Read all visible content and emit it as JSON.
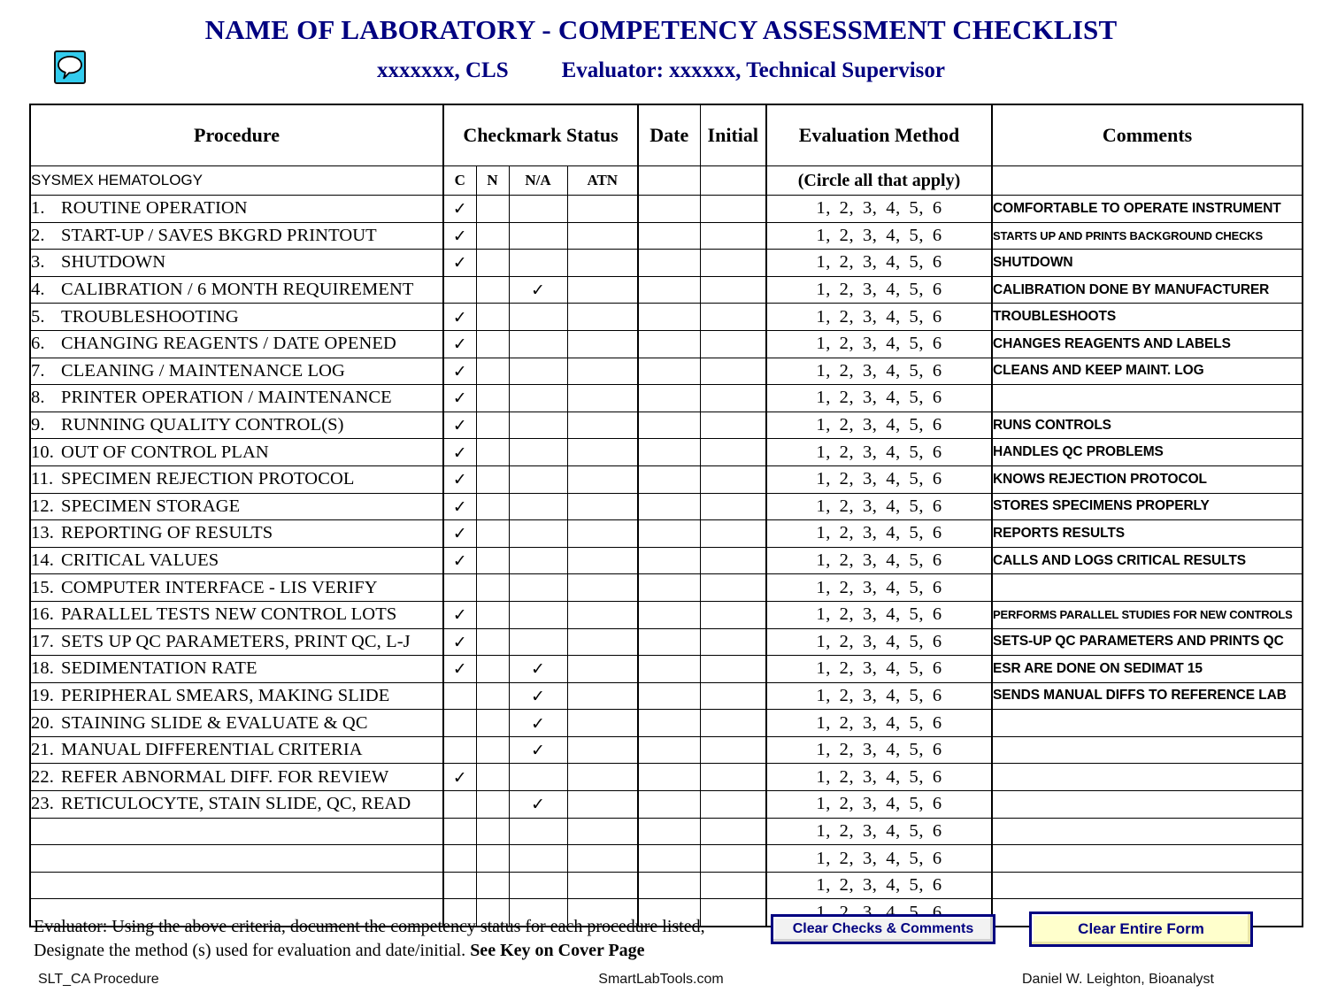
{
  "header": {
    "title": "NAME OF LABORATORY - COMPETENCY ASSESSMENT CHECKLIST",
    "employee": "xxxxxxx, CLS",
    "evaluator": "Evaluator: xxxxxx, Technical Supervisor",
    "comment_icon": "speech-bubble-comment-icon",
    "title_color": "#000080",
    "icon_color": "#33ccee"
  },
  "table": {
    "headers": {
      "procedure": "Procedure",
      "checkmark_status": "Checkmark Status",
      "date": "Date",
      "initial": "Initial",
      "evaluation_method": "Evaluation Method",
      "comments": "Comments"
    },
    "subheaders": {
      "section": "SYSMEX HEMATOLOGY",
      "c": "C",
      "n": "N",
      "na": "N/A",
      "atn": "ATN",
      "date": "",
      "initial": "",
      "evaluation_method": "(Circle all that apply)",
      "comments": ""
    },
    "eval_methods": "1,  2,  3,  4,  5,  6",
    "check_glyph": "✓",
    "rows": [
      {
        "num": "1.",
        "procedure": "ROUTINE OPERATION",
        "c": true,
        "n": false,
        "na": false,
        "atn": false,
        "date": "",
        "initial": "",
        "eval": "1,  2,  3,  4,  5,  6",
        "comment": "COMFORTABLE TO OPERATE INSTRUMENT",
        "comment_small": false
      },
      {
        "num": "2.",
        "procedure": "START-UP / SAVES BKGRD PRINTOUT",
        "c": true,
        "n": false,
        "na": false,
        "atn": false,
        "date": "",
        "initial": "",
        "eval": "1,  2,  3,  4,  5,  6",
        "comment": "STARTS UP AND PRINTS BACKGROUND CHECKS",
        "comment_small": true
      },
      {
        "num": "3.",
        "procedure": "SHUTDOWN",
        "c": true,
        "n": false,
        "na": false,
        "atn": false,
        "date": "",
        "initial": "",
        "eval": "1,  2,  3,  4,  5,  6",
        "comment": "SHUTDOWN",
        "comment_small": false
      },
      {
        "num": "4.",
        "procedure": "CALIBRATION / 6 MONTH REQUIREMENT",
        "c": false,
        "n": false,
        "na": true,
        "atn": false,
        "date": "",
        "initial": "",
        "eval": "1,  2,  3,  4,  5,  6",
        "comment": "CALIBRATION DONE BY MANUFACTURER",
        "comment_small": false
      },
      {
        "num": "5.",
        "procedure": "TROUBLESHOOTING",
        "c": true,
        "n": false,
        "na": false,
        "atn": false,
        "date": "",
        "initial": "",
        "eval": "1,  2,  3,  4,  5,  6",
        "comment": "TROUBLESHOOTS",
        "comment_small": false
      },
      {
        "num": "6.",
        "procedure": "CHANGING REAGENTS / DATE OPENED",
        "c": true,
        "n": false,
        "na": false,
        "atn": false,
        "date": "",
        "initial": "",
        "eval": "1,  2,  3,  4,  5,  6",
        "comment": "CHANGES REAGENTS AND LABELS",
        "comment_small": false
      },
      {
        "num": "7.",
        "procedure": "CLEANING / MAINTENANCE LOG",
        "c": true,
        "n": false,
        "na": false,
        "atn": false,
        "date": "",
        "initial": "",
        "eval": "1,  2,  3,  4,  5,  6",
        "comment": "CLEANS AND KEEP MAINT. LOG",
        "comment_small": false
      },
      {
        "num": "8.",
        "procedure": "PRINTER OPERATION / MAINTENANCE",
        "c": true,
        "n": false,
        "na": false,
        "atn": false,
        "date": "",
        "initial": "",
        "eval": "1,  2,  3,  4,  5,  6",
        "comment": "",
        "comment_small": false
      },
      {
        "num": "9.",
        "procedure": "RUNNING QUALITY CONTROL(S)",
        "c": true,
        "n": false,
        "na": false,
        "atn": false,
        "date": "",
        "initial": "",
        "eval": "1,  2,  3,  4,  5,  6",
        "comment": "RUNS CONTROLS",
        "comment_small": false
      },
      {
        "num": "10.",
        "procedure": "OUT OF CONTROL PLAN",
        "c": true,
        "n": false,
        "na": false,
        "atn": false,
        "date": "",
        "initial": "",
        "eval": "1,  2,  3,  4,  5,  6",
        "comment": "HANDLES QC PROBLEMS",
        "comment_small": false
      },
      {
        "num": "11.",
        "procedure": "SPECIMEN REJECTION PROTOCOL",
        "c": true,
        "n": false,
        "na": false,
        "atn": false,
        "date": "",
        "initial": "",
        "eval": "1,  2,  3,  4,  5,  6",
        "comment": "KNOWS REJECTION PROTOCOL",
        "comment_small": false
      },
      {
        "num": "12.",
        "procedure": "SPECIMEN STORAGE",
        "c": true,
        "n": false,
        "na": false,
        "atn": false,
        "date": "",
        "initial": "",
        "eval": "1,  2,  3,  4,  5,  6",
        "comment": "STORES SPECIMENS PROPERLY",
        "comment_small": false
      },
      {
        "num": "13.",
        "procedure": "REPORTING OF RESULTS",
        "c": true,
        "n": false,
        "na": false,
        "atn": false,
        "date": "",
        "initial": "",
        "eval": "1,  2,  3,  4,  5,  6",
        "comment": "REPORTS RESULTS",
        "comment_small": false
      },
      {
        "num": "14.",
        "procedure": "CRITICAL VALUES",
        "c": true,
        "n": false,
        "na": false,
        "atn": false,
        "date": "",
        "initial": "",
        "eval": "1,  2,  3,  4,  5,  6",
        "comment": "CALLS AND LOGS CRITICAL RESULTS",
        "comment_small": false
      },
      {
        "num": "15.",
        "procedure": "COMPUTER INTERFACE - LIS VERIFY",
        "c": false,
        "n": false,
        "na": false,
        "atn": false,
        "date": "",
        "initial": "",
        "eval": "1,  2,  3,  4,  5,  6",
        "comment": "",
        "comment_small": false
      },
      {
        "num": "16.",
        "procedure": "PARALLEL TESTS NEW CONTROL LOTS",
        "c": true,
        "n": false,
        "na": false,
        "atn": false,
        "date": "",
        "initial": "",
        "eval": "1,  2,  3,  4,  5,  6",
        "comment": "PERFORMS PARALLEL STUDIES FOR NEW CONTROLS",
        "comment_small": true
      },
      {
        "num": "17.",
        "procedure": "SETS UP QC PARAMETERS, PRINT QC, L-J",
        "c": true,
        "n": false,
        "na": false,
        "atn": false,
        "date": "",
        "initial": "",
        "eval": "1,  2,  3,  4,  5,  6",
        "comment": "SETS-UP QC PARAMETERS AND PRINTS QC",
        "comment_small": false
      },
      {
        "num": "18.",
        "procedure": "SEDIMENTATION RATE",
        "c": true,
        "n": false,
        "na": true,
        "atn": false,
        "date": "",
        "initial": "",
        "eval": "1,  2,  3,  4,  5,  6",
        "comment": "ESR ARE DONE ON SEDIMAT 15",
        "comment_small": false
      },
      {
        "num": "19.",
        "procedure": "PERIPHERAL SMEARS, MAKING SLIDE",
        "c": false,
        "n": false,
        "na": true,
        "atn": false,
        "date": "",
        "initial": "",
        "eval": "1,  2,  3,  4,  5,  6",
        "comment": "SENDS MANUAL DIFFS TO REFERENCE LAB",
        "comment_small": false
      },
      {
        "num": "20.",
        "procedure": "STAINING SLIDE & EVALUATE & QC",
        "c": false,
        "n": false,
        "na": true,
        "atn": false,
        "date": "",
        "initial": "",
        "eval": "1,  2,  3,  4,  5,  6",
        "comment": "",
        "comment_small": false
      },
      {
        "num": "21.",
        "procedure": "MANUAL DIFFERENTIAL CRITERIA",
        "c": false,
        "n": false,
        "na": true,
        "atn": false,
        "date": "",
        "initial": "",
        "eval": "1,  2,  3,  4,  5,  6",
        "comment": "",
        "comment_small": false
      },
      {
        "num": "22.",
        "procedure": "REFER ABNORMAL DIFF. FOR REVIEW",
        "c": true,
        "n": false,
        "na": false,
        "atn": false,
        "date": "",
        "initial": "",
        "eval": "1,  2,  3,  4,  5,  6",
        "comment": "",
        "comment_small": false
      },
      {
        "num": "23.",
        "procedure": "RETICULOCYTE, STAIN SLIDE, QC, READ",
        "c": false,
        "n": false,
        "na": true,
        "atn": false,
        "date": "",
        "initial": "",
        "eval": "1,  2,  3,  4,  5,  6",
        "comment": "",
        "comment_small": false
      },
      {
        "num": "",
        "procedure": "",
        "c": false,
        "n": false,
        "na": false,
        "atn": false,
        "date": "",
        "initial": "",
        "eval": "1,  2,  3,  4,  5,  6",
        "comment": "",
        "comment_small": false
      },
      {
        "num": "",
        "procedure": "",
        "c": false,
        "n": false,
        "na": false,
        "atn": false,
        "date": "",
        "initial": "",
        "eval": "1,  2,  3,  4,  5,  6",
        "comment": "",
        "comment_small": false
      },
      {
        "num": "",
        "procedure": "",
        "c": false,
        "n": false,
        "na": false,
        "atn": false,
        "date": "",
        "initial": "",
        "eval": "1,  2,  3,  4,  5,  6",
        "comment": "",
        "comment_small": false
      },
      {
        "num": "",
        "procedure": "",
        "c": false,
        "n": false,
        "na": false,
        "atn": false,
        "date": "",
        "initial": "",
        "eval": "1,  2,  3,  4,  5,  6",
        "comment": "",
        "comment_small": false
      }
    ]
  },
  "footer_note": {
    "line1": "Evaluator: Using the above criteria, document the competency status for each procedure listed,",
    "line2_part1": "Designate the method (s) used for evaluation and date/initial.",
    "line2_bold": "See Key on Cover Page"
  },
  "buttons": {
    "clear_checks": "Clear Checks & Comments",
    "clear_form": "Clear Entire Form",
    "border_color": "#000080",
    "clear_form_bg": "#ffffcc"
  },
  "page_footer": {
    "left": "SLT_CA Procedure",
    "center": "SmartLabTools.com",
    "right": "Daniel W. Leighton, Bioanalyst"
  }
}
